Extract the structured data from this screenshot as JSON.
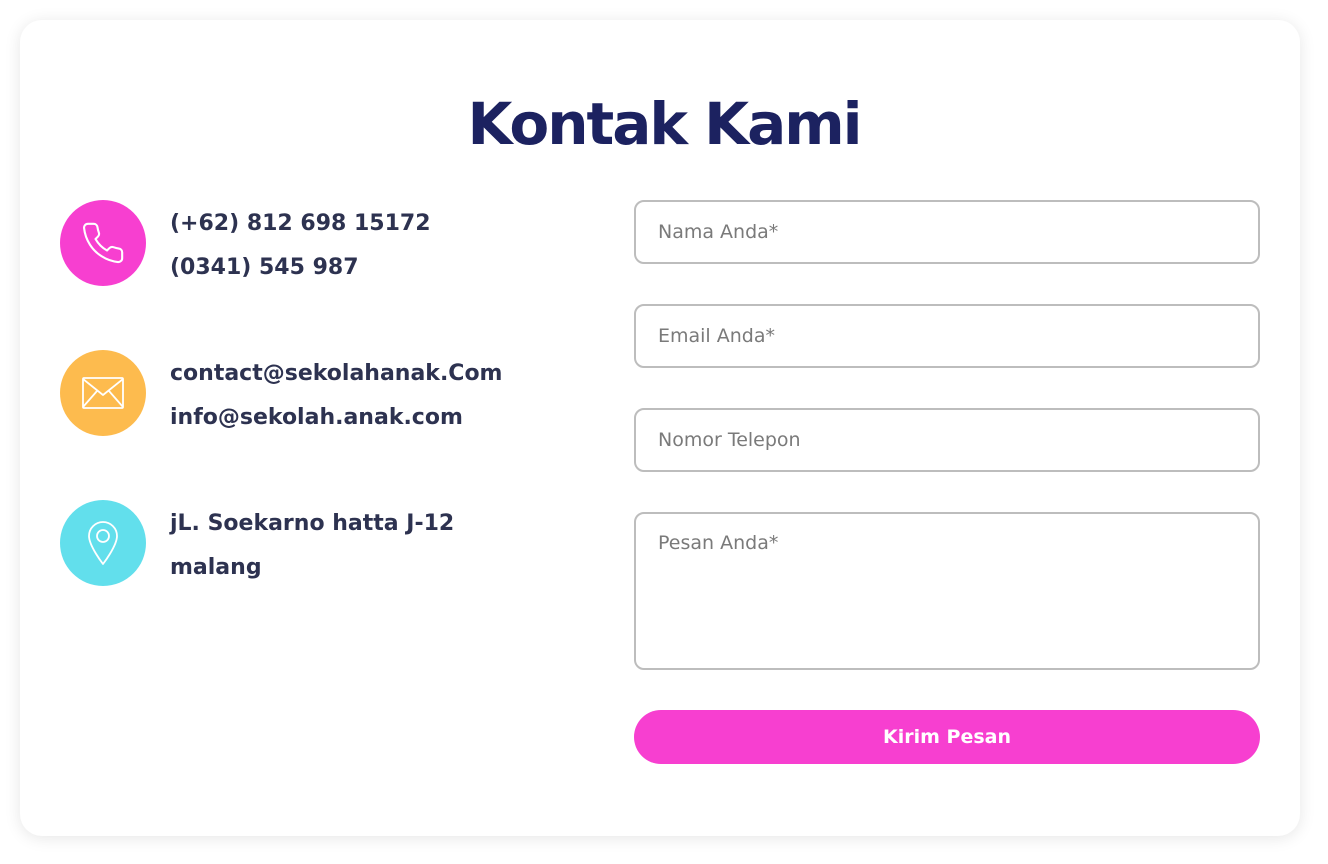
{
  "title": "Kontak Kami",
  "colors": {
    "title": "#1c2260",
    "text": "#2d3250",
    "phone_circle": "#f73fd0",
    "email_circle": "#fdbb4e",
    "location_circle": "#62dfec",
    "button": "#f73fd0",
    "border": "#bdbdbd"
  },
  "contact_info": {
    "phone": {
      "icon": "phone-icon",
      "lines": [
        "(+62) 812 698 15172",
        "(0341) 545 987"
      ]
    },
    "email": {
      "icon": "envelope-icon",
      "lines": [
        "contact@sekolahanak.Com",
        "info@sekolah.anak.com"
      ]
    },
    "address": {
      "icon": "location-pin-icon",
      "lines": [
        "jL. Soekarno hatta J-12",
        "malang"
      ]
    }
  },
  "form": {
    "name_placeholder": "Nama Anda*",
    "email_placeholder": "Email Anda*",
    "phone_placeholder": "Nomor Telepon",
    "message_placeholder": "Pesan Anda*",
    "submit_label": "Kirim Pesan"
  }
}
